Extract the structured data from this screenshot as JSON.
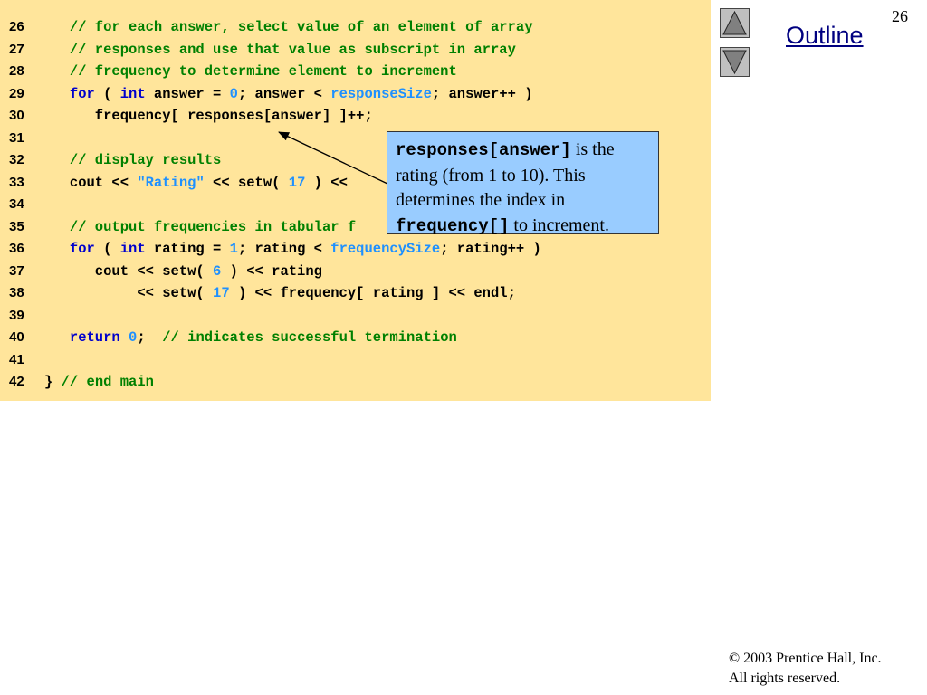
{
  "page_number": "26",
  "outline": {
    "label": "Outline"
  },
  "nav": {
    "up_icon": "triangle-up-icon",
    "down_icon": "triangle-down-icon"
  },
  "code_lines": [
    {
      "num": "26",
      "tokens": [
        {
          "t": "   "
        },
        {
          "c": "comment",
          "t": "// for each answer, select value of an element of array"
        }
      ]
    },
    {
      "num": "27",
      "tokens": [
        {
          "t": "   "
        },
        {
          "c": "comment",
          "t": "// responses and use that value as subscript in array"
        }
      ]
    },
    {
      "num": "28",
      "tokens": [
        {
          "t": "   "
        },
        {
          "c": "comment",
          "t": "// frequency to determine element to increment"
        }
      ]
    },
    {
      "num": "29",
      "tokens": [
        {
          "t": "   "
        },
        {
          "c": "keyword",
          "t": "for"
        },
        {
          "t": " ( "
        },
        {
          "c": "keyword",
          "t": "int"
        },
        {
          "t": " answer = "
        },
        {
          "c": "number",
          "t": "0"
        },
        {
          "t": "; answer < "
        },
        {
          "c": "ident",
          "t": "responseSize"
        },
        {
          "t": "; answer++ )"
        }
      ]
    },
    {
      "num": "30",
      "tokens": [
        {
          "t": "      frequency[ responses[answer] ]++;"
        }
      ]
    },
    {
      "num": "31",
      "tokens": []
    },
    {
      "num": "32",
      "tokens": [
        {
          "t": "   "
        },
        {
          "c": "comment",
          "t": "// display results"
        }
      ]
    },
    {
      "num": "33",
      "tokens": [
        {
          "t": "   cout << "
        },
        {
          "c": "string",
          "t": "\"Rating\""
        },
        {
          "t": " << setw( "
        },
        {
          "c": "number",
          "t": "17"
        },
        {
          "t": " ) <<"
        }
      ]
    },
    {
      "num": "34",
      "tokens": []
    },
    {
      "num": "35",
      "tokens": [
        {
          "t": "   "
        },
        {
          "c": "comment",
          "t": "// output frequencies in tabular f"
        }
      ]
    },
    {
      "num": "36",
      "tokens": [
        {
          "t": "   "
        },
        {
          "c": "keyword",
          "t": "for"
        },
        {
          "t": " ( "
        },
        {
          "c": "keyword",
          "t": "int"
        },
        {
          "t": " rating = "
        },
        {
          "c": "number",
          "t": "1"
        },
        {
          "t": "; rating < "
        },
        {
          "c": "ident",
          "t": "frequencySize"
        },
        {
          "t": "; rating++ )"
        }
      ]
    },
    {
      "num": "37",
      "tokens": [
        {
          "t": "      cout << setw( "
        },
        {
          "c": "number",
          "t": "6"
        },
        {
          "t": " ) << rating"
        }
      ]
    },
    {
      "num": "38",
      "tokens": [
        {
          "t": "           << setw( "
        },
        {
          "c": "number",
          "t": "17"
        },
        {
          "t": " ) << frequency[ rating ] << endl;"
        }
      ]
    },
    {
      "num": "39",
      "tokens": []
    },
    {
      "num": "40",
      "tokens": [
        {
          "t": "   "
        },
        {
          "c": "keyword",
          "t": "return"
        },
        {
          "t": " "
        },
        {
          "c": "number",
          "t": "0"
        },
        {
          "t": ";  "
        },
        {
          "c": "comment",
          "t": "// indicates successful termination"
        }
      ]
    },
    {
      "num": "41",
      "tokens": []
    },
    {
      "num": "42",
      "tokens": [
        {
          "t": "} "
        },
        {
          "c": "comment",
          "t": "// end main"
        }
      ]
    }
  ],
  "callout": {
    "code1": "responses[answer]",
    "text1": " is the rating (from 1 to 10). This determines the index in ",
    "code2": "frequency[]",
    "text2": " to increment."
  },
  "footer": {
    "copyright": "© 2003 Prentice Hall, Inc.",
    "rights": "All rights reserved."
  },
  "colors": {
    "code_background": "#ffe59b",
    "callout_background": "#99ccff",
    "comment": "#008000",
    "keyword": "#0000cc",
    "literal": "#1e90ff",
    "outline_link": "#000080"
  }
}
